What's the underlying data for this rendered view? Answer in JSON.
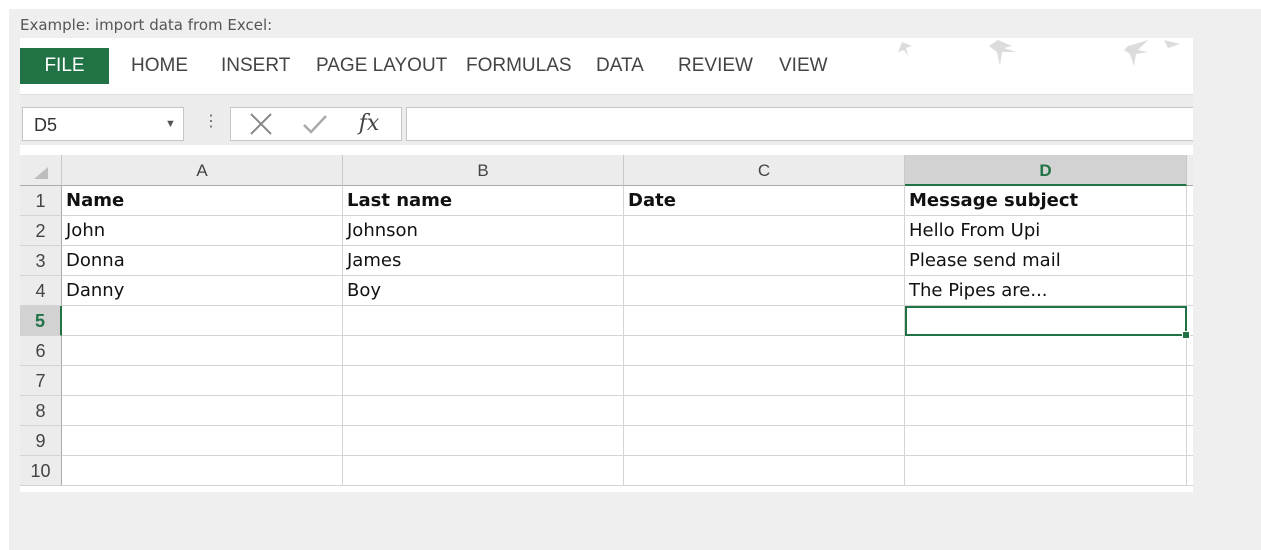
{
  "caption": "Example: import data from Excel:",
  "ribbon": {
    "tabs": [
      "FILE",
      "HOME",
      "INSERT",
      "PAGE LAYOUT",
      "FORMULAS",
      "DATA",
      "REVIEW",
      "VIEW"
    ],
    "active_tab": "FILE",
    "accent_color": "#217346"
  },
  "formula_bar": {
    "name_box": "D5",
    "name_box_dropdown_icon": "dropdown-arrow-icon",
    "cancel_icon": "cross-icon",
    "enter_icon": "check-icon",
    "fx_label": "fx",
    "formula_value": ""
  },
  "sheet": {
    "columns": [
      "A",
      "B",
      "C",
      "D"
    ],
    "selected_column": "D",
    "selected_row": "5",
    "active_cell": "D5",
    "rows": [
      {
        "num": "1",
        "cells": [
          "Name",
          "Last name",
          "Date",
          "Message subject"
        ]
      },
      {
        "num": "2",
        "cells": [
          "John",
          "Johnson",
          "",
          "Hello From Upi"
        ]
      },
      {
        "num": "3",
        "cells": [
          "Donna",
          "James",
          "",
          "Please send mail"
        ]
      },
      {
        "num": "4",
        "cells": [
          "Danny",
          "Boy",
          "",
          "The Pipes are..."
        ]
      },
      {
        "num": "5",
        "cells": [
          "",
          "",
          "",
          ""
        ]
      },
      {
        "num": "6",
        "cells": [
          "",
          "",
          "",
          ""
        ]
      },
      {
        "num": "7",
        "cells": [
          "",
          "",
          "",
          ""
        ]
      },
      {
        "num": "8",
        "cells": [
          "",
          "",
          "",
          ""
        ]
      },
      {
        "num": "9",
        "cells": [
          "",
          "",
          "",
          ""
        ]
      },
      {
        "num": "10",
        "cells": [
          "",
          "",
          "",
          ""
        ]
      }
    ]
  }
}
